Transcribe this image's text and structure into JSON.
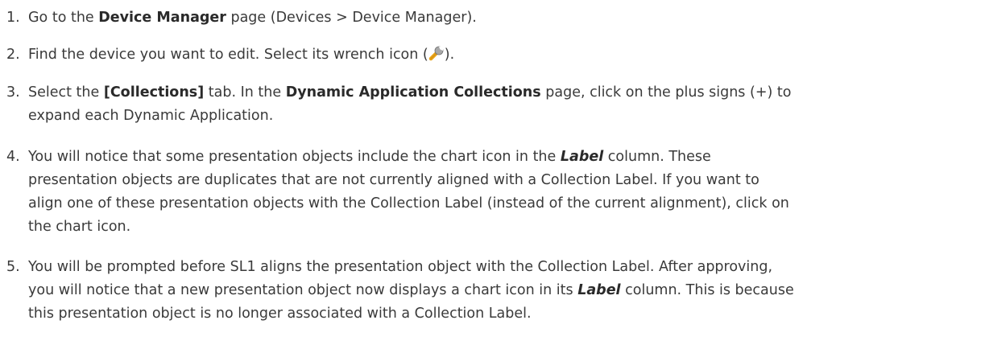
{
  "steps": [
    {
      "num": "1.",
      "p1": "Go to the ",
      "b1": "Device Manager",
      "p2": " page (Devices > Device Manager)."
    },
    {
      "num": "2.",
      "p1": "Find the device you want to edit. Select its wrench icon (",
      "icon": "wrench-icon",
      "p2": ")."
    },
    {
      "num": "3.",
      "p1": "Select the ",
      "b1": "[Collections]",
      "p2": " tab. In the ",
      "b2": "Dynamic Application Collections",
      "p3": " page, click on the plus signs (+) to",
      "p4": "expand each Dynamic Application."
    },
    {
      "num": "4.",
      "p1": "You will notice that some presentation objects include the chart icon in the ",
      "i1": "Label",
      "p2": " column. These",
      "p3": "presentation objects are duplicates that are not currently aligned with a Collection Label. If you want to",
      "p4": "align one of these presentation objects with the Collection Label (instead of the current alignment), click on",
      "p5": "the chart icon."
    },
    {
      "num": "5.",
      "p1": "You will be prompted before SL1 aligns the presentation object with the Collection Label. After approving,",
      "p2": "you will notice that a new presentation object now displays a chart icon in its ",
      "i1": "Label",
      "p3": " column. This is because",
      "p4": "this presentation object is no longer associated with a Collection Label."
    }
  ],
  "colors": {
    "text": "#3a3a3a",
    "wrench_handle": "#e8a317",
    "wrench_head": "#9a9a9a"
  }
}
